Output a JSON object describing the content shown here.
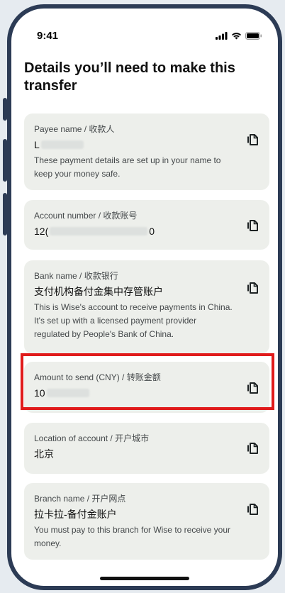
{
  "status": {
    "time": "9:41"
  },
  "heading": "Details you’ll need to make this transfer",
  "cards": [
    {
      "label": "Payee name / 收款人",
      "value": "L",
      "desc": "These payment details are set up in your name to keep your money safe."
    },
    {
      "label": "Account number / 收款账号",
      "value_start": "12(",
      "value_end": "0"
    },
    {
      "label": "Bank name / 收款银行",
      "value": "支付机构备付金集中存管账户",
      "desc": "This is Wise's account to receive payments in China. It's set up with a licensed payment provider regulated by People's Bank of China."
    },
    {
      "label": "Amount to send (CNY) / 转账金额",
      "value": "10"
    },
    {
      "label": "Location of account / 开户城市",
      "value": "北京"
    },
    {
      "label": "Branch name / 开户网点",
      "value": "拉卡拉-备付金账户",
      "desc": "You must pay to this branch for Wise to receive your money."
    }
  ],
  "icons": {
    "copy": "copy-icon",
    "signal": "cellular-signal-icon",
    "wifi": "wifi-icon",
    "battery": "battery-icon"
  },
  "colors": {
    "frame": "#2c3b55",
    "card_bg": "#edefeb",
    "highlight": "#e01b1b"
  }
}
